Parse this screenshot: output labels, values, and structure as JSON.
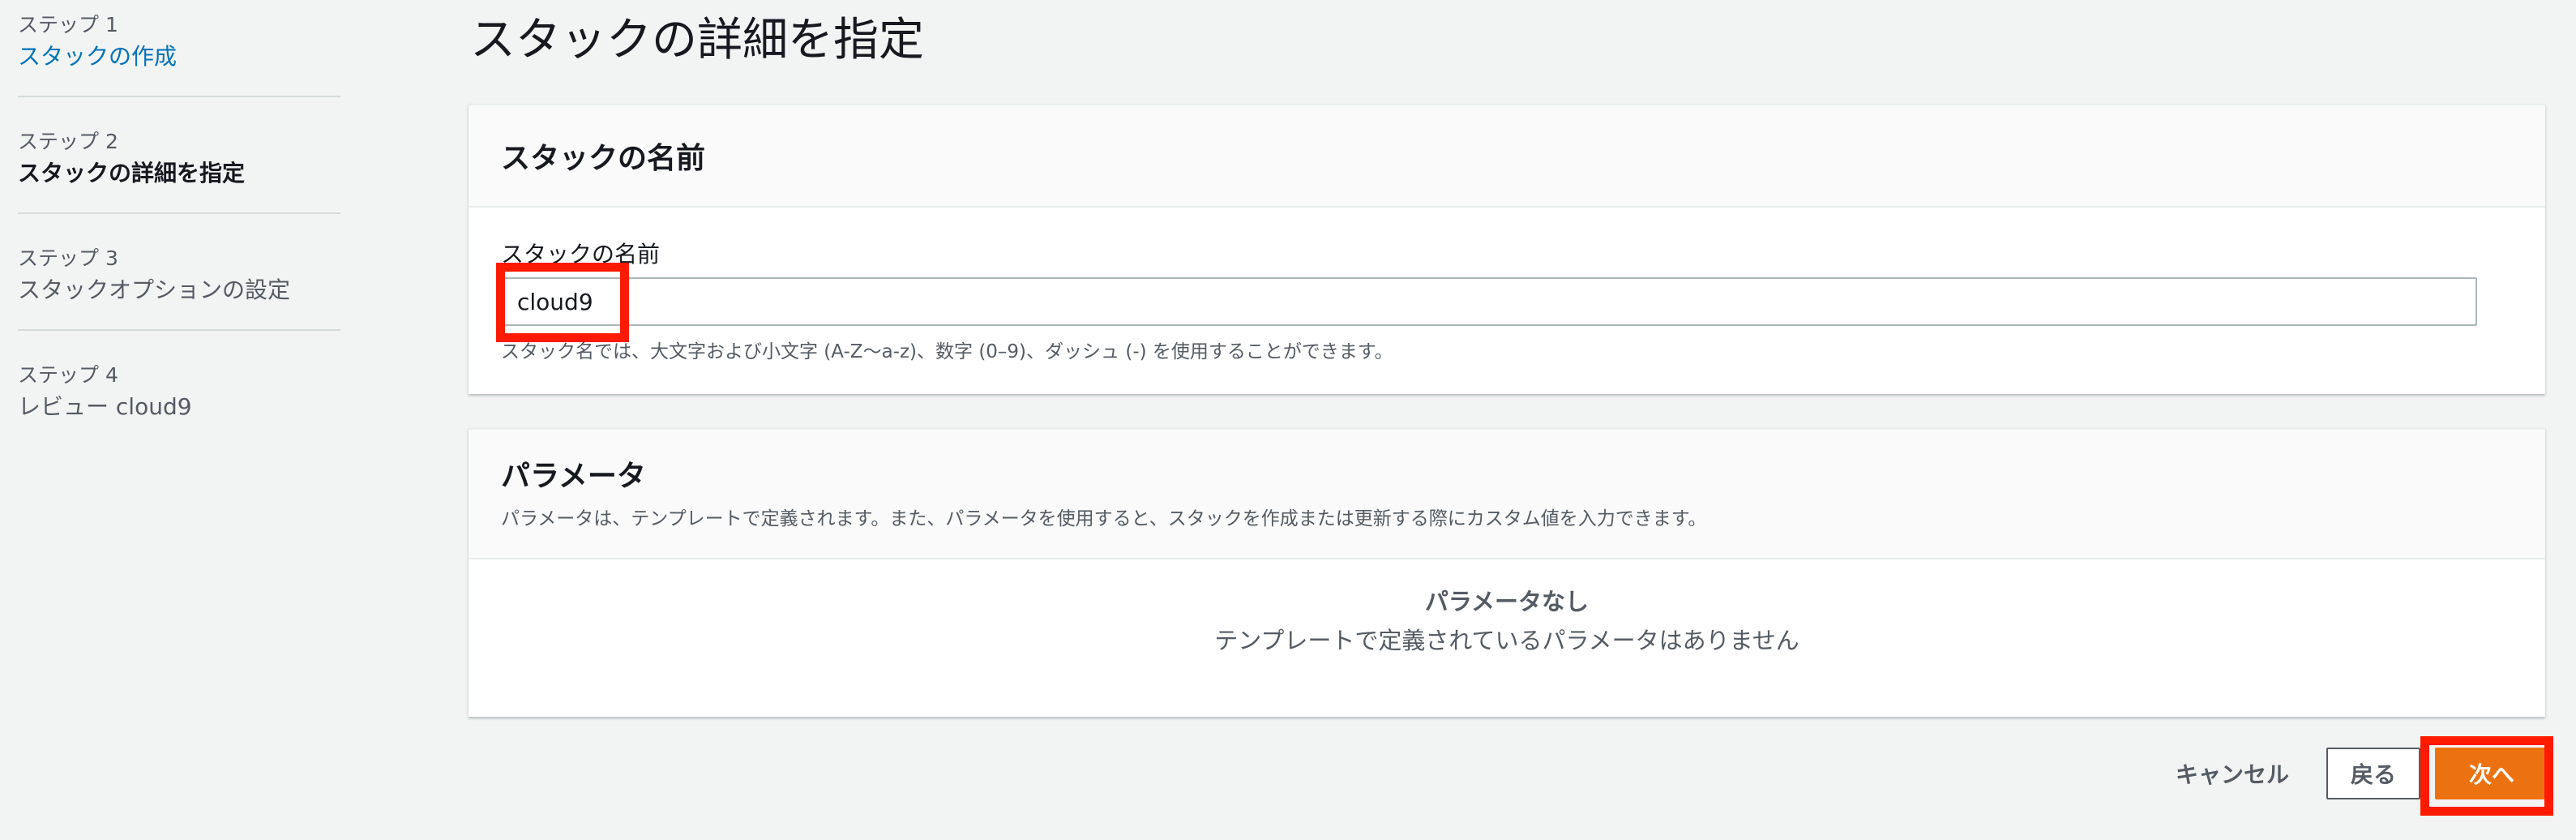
{
  "wizard": {
    "steps": [
      {
        "number": "ステップ 1",
        "title": "スタックの作成",
        "state": "link"
      },
      {
        "number": "ステップ 2",
        "title": "スタックの詳細を指定",
        "state": "current"
      },
      {
        "number": "ステップ 3",
        "title": "スタックオプションの設定",
        "state": "default"
      },
      {
        "number": "ステップ 4",
        "title": "レビュー cloud9",
        "state": "default"
      }
    ]
  },
  "page": {
    "title": "スタックの詳細を指定"
  },
  "stack_name_panel": {
    "title": "スタックの名前",
    "field_label": "スタックの名前",
    "field_value": "cloud9",
    "field_hint": "スタック名では、大文字および小文字 (A-Z〜a-z)、数字 (0–9)、ダッシュ (-) を使用することができます。"
  },
  "parameters_panel": {
    "title": "パラメータ",
    "description": "パラメータは、テンプレートで定義されます。また、パラメータを使用すると、スタックを作成または更新する際にカスタム値を入力できます。",
    "empty_title": "パラメータなし",
    "empty_description": "テンプレートで定義されているパラメータはありません"
  },
  "actions": {
    "cancel_label": "キャンセル",
    "back_label": "戻る",
    "next_label": "次へ"
  },
  "colors": {
    "accent": "#ec7211",
    "link": "#0073bb",
    "highlight": "#ff1a00",
    "background": "#f2f3f3"
  }
}
